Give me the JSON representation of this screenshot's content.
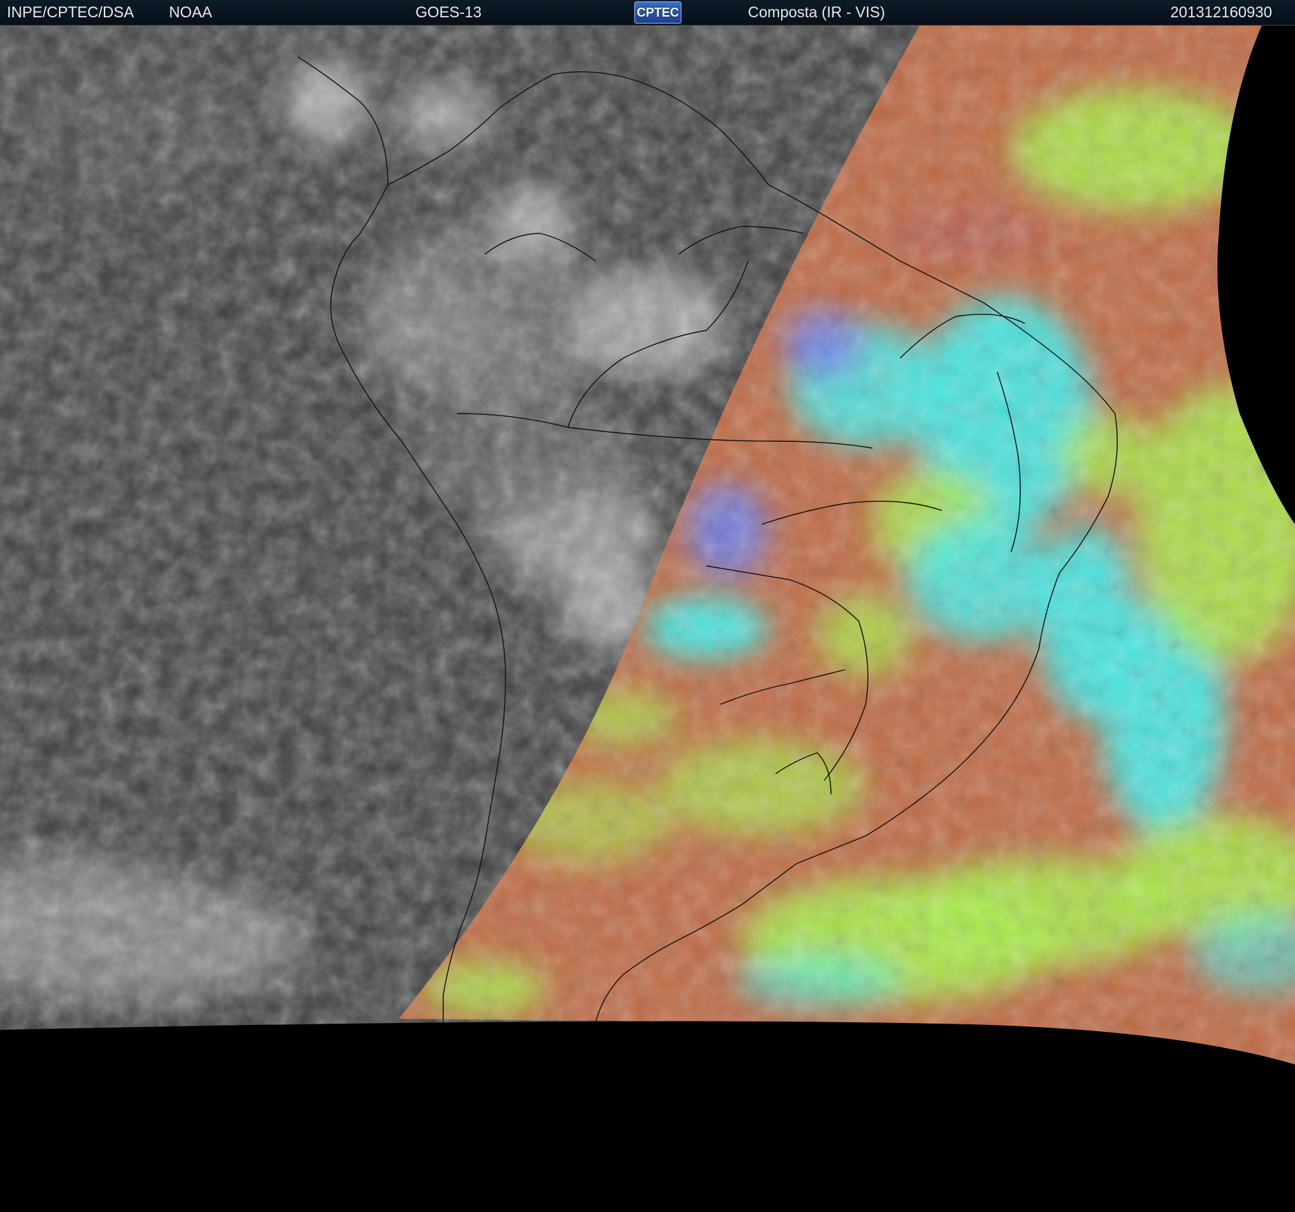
{
  "header": {
    "institution": "INPE/CPTEC/DSA",
    "agency": "NOAA",
    "satellite": "GOES-13",
    "logo_text": "CPTEC",
    "product": "Composta (IR - VIS)",
    "timestamp": "201312160930"
  },
  "colors": {
    "header_bg": "#0d1b2a",
    "night_ir": "#3f3f3f",
    "composite_orange": "#c06a44",
    "composite_green": "#a8ee48",
    "composite_cyan": "#3ff0ee",
    "space": "#000000"
  }
}
